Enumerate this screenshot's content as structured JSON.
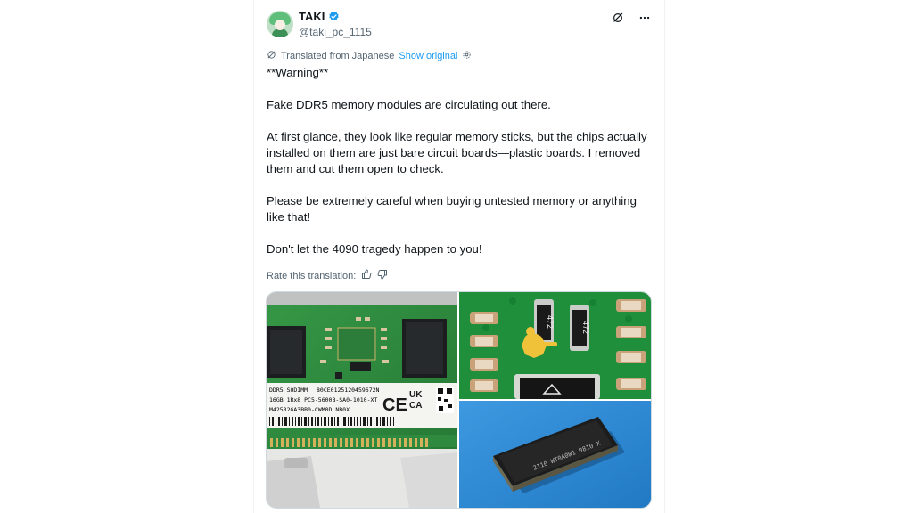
{
  "author": {
    "name": "TAKI",
    "handle": "@taki_pc_1115"
  },
  "translation": {
    "note": "Translated from Japanese",
    "show_original": "Show original",
    "rate_label": "Rate this translation:"
  },
  "tweet": {
    "paragraphs": [
      "**Warning**",
      "Fake DDR5 memory modules are circulating out there.",
      "At first glance, they look like regular memory sticks, but the chips actually installed on them are just bare circuit boards—plastic boards. I removed them and cut them open to check.",
      "Please be extremely careful when buying untested memory or anything like that!",
      "Don't let the 4090 tragedy happen to you!"
    ]
  },
  "media": {
    "sticker": {
      "line1": "DDR5 SODIMM",
      "line1b": "80CE0125120459672N",
      "line2": "16GB 1Rx8 PC5-5600B-SA0-1010-XT",
      "line3": "M425R2GA3BB0-CWM0D  NB0X",
      "ce": "CE",
      "ukca_top": "UK",
      "ukca_bottom": "CA"
    },
    "resistor_1": "472",
    "resistor_2": "472",
    "chip_text": "2110 WT0A0W1 0810 X"
  },
  "colors": {
    "accent": "#1d9bf0",
    "text": "#0f1419",
    "muted": "#536471"
  }
}
